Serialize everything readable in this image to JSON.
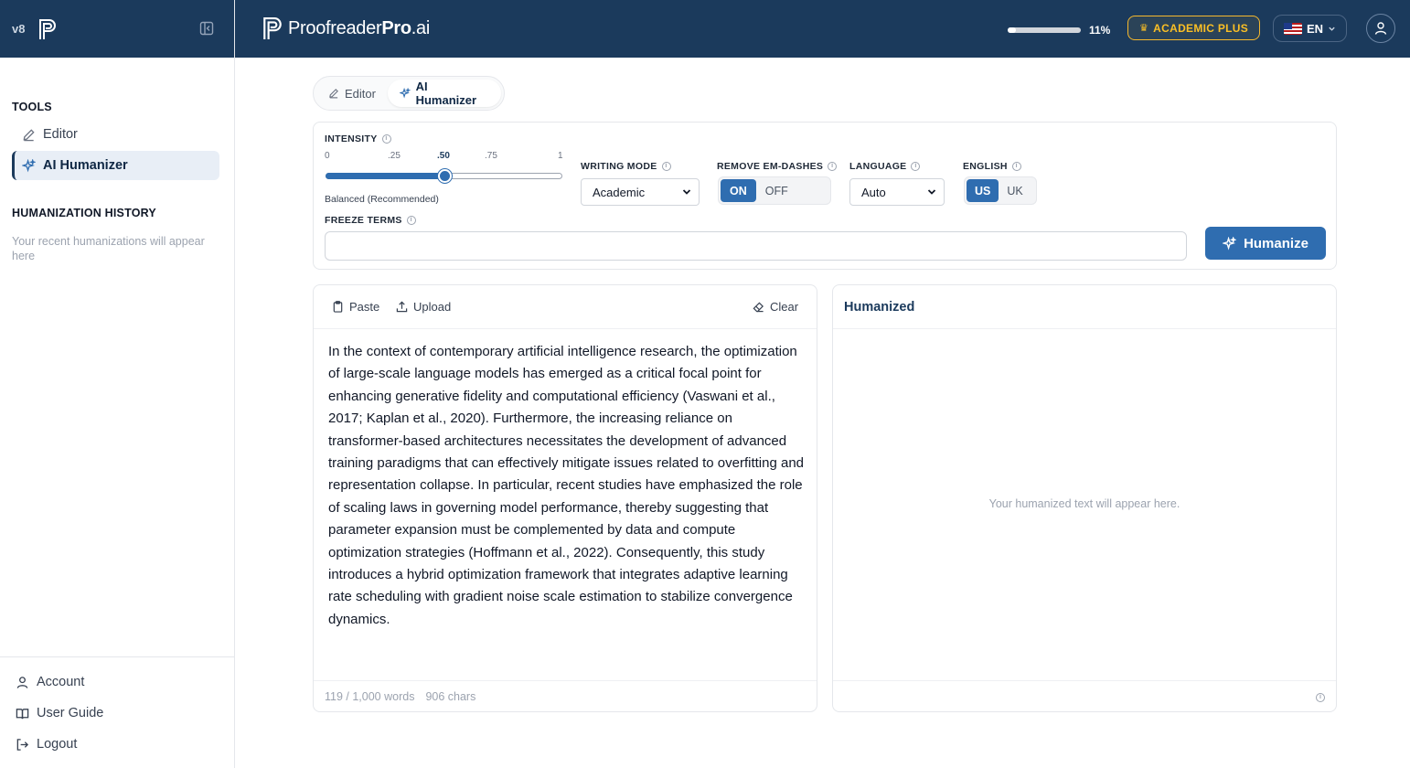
{
  "sidebar": {
    "version": "v8",
    "tools_heading": "TOOLS",
    "items": [
      {
        "label": "Editor",
        "icon": "pencil-icon"
      },
      {
        "label": "AI Humanizer",
        "icon": "sparkles-icon"
      }
    ],
    "history_heading": "HUMANIZATION HISTORY",
    "history_empty": "Your recent humanizations will appear here",
    "links": [
      {
        "label": "Account",
        "icon": "user-icon"
      },
      {
        "label": "User Guide",
        "icon": "book-icon"
      },
      {
        "label": "Logout",
        "icon": "logout-icon"
      }
    ]
  },
  "topbar": {
    "brand_light": "Proofreader",
    "brand_bold": "Pro",
    "brand_suffix": ".ai",
    "usage_percent_text": "11%",
    "usage_fraction": 0.11,
    "plan": "ACADEMIC PLUS",
    "language": "EN"
  },
  "tabs": [
    {
      "label": "Editor",
      "active": false
    },
    {
      "label": "AI Humanizer",
      "active": true
    }
  ],
  "settings": {
    "intensity_label": "INTENSITY",
    "intensity_ticks": [
      "0",
      ".25",
      ".50",
      ".75",
      "1"
    ],
    "intensity_value": 0.5,
    "intensity_caption": "Balanced (Recommended)",
    "writing_mode_label": "WRITING MODE",
    "writing_mode_value": "Academic",
    "em_dash_label": "REMOVE EM-DASHES",
    "em_dash_on": "ON",
    "em_dash_off": "OFF",
    "language_label": "LANGUAGE",
    "language_value": "Auto",
    "english_label": "ENGLISH",
    "english_us": "US",
    "english_uk": "UK",
    "freeze_label": "FREEZE TERMS",
    "freeze_value": "",
    "humanize_label": "Humanize"
  },
  "input_panel": {
    "paste_label": "Paste",
    "upload_label": "Upload",
    "clear_label": "Clear",
    "text": "In the context of contemporary artificial intelligence research, the optimization of large-scale language models has emerged as a critical focal point for enhancing generative fidelity and computational efficiency (Vaswani et al., 2017; Kaplan et al., 2020). Furthermore, the increasing reliance on transformer-based architectures necessitates the development of advanced training paradigms that can effectively mitigate issues related to overfitting and representation collapse. In particular, recent studies have emphasized the role of scaling laws in governing model performance, thereby suggesting that parameter expansion must be complemented by data and compute optimization strategies (Hoffmann et al., 2022). Consequently, this study introduces a hybrid optimization framework that integrates adaptive learning rate scheduling with gradient noise scale estimation to stabilize convergence dynamics.",
    "word_count": "119 / 1,000 words",
    "char_count": "906 chars"
  },
  "output_panel": {
    "title": "Humanized",
    "empty": "Your humanized text will appear here."
  },
  "colors": {
    "navy": "#1b3a5c",
    "accent": "#2f6db0",
    "gold": "#f5b82e"
  }
}
